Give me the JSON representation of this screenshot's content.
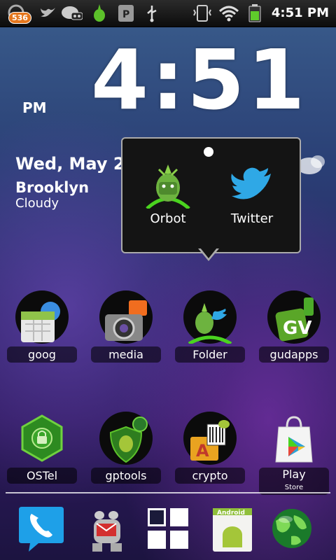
{
  "status_bar": {
    "badge_count": "536",
    "time": "4:51 PM",
    "icons": [
      "notification-icon",
      "twitter-icon",
      "voicemail-icon",
      "orbot-status-icon",
      "parking-icon",
      "usb-icon",
      "vibrate-icon",
      "wifi-icon",
      "battery-icon"
    ],
    "battery_color": "#5fcc2b"
  },
  "clock_widget": {
    "time": "4:51",
    "ampm": "PM",
    "date": "Wed, May 2",
    "location": "Brooklyn",
    "condition": "Cloudy"
  },
  "folder_popup": {
    "apps": [
      {
        "label": "Orbot",
        "icon": "orbot-icon"
      },
      {
        "label": "Twitter",
        "icon": "twitter-bird-icon"
      }
    ]
  },
  "home_row1": [
    {
      "label": "goog",
      "icon": "calendar-icon"
    },
    {
      "label": "media",
      "icon": "camera-icon"
    },
    {
      "label": "Folder",
      "icon": "folder-icon"
    },
    {
      "label": "gudapps",
      "icon": "google-voice-icon"
    }
  ],
  "home_row2": [
    {
      "label": "OSTel",
      "icon": "ostel-icon"
    },
    {
      "label": "gptools",
      "icon": "android-shield-icon"
    },
    {
      "label": "crypto",
      "icon": "crypto-folder-icon"
    },
    {
      "label": "Play",
      "sublabel": "Store",
      "icon": "play-store-icon"
    }
  ],
  "dock": [
    {
      "icon": "phone-icon"
    },
    {
      "icon": "messaging-robot-icon"
    },
    {
      "icon": "app-drawer-icon"
    },
    {
      "icon": "android-market-icon"
    },
    {
      "icon": "browser-globe-icon"
    }
  ],
  "colors": {
    "accent_green": "#4ad31f",
    "twitter_blue": "#2fa8e6",
    "phone_blue": "#1ea0e8"
  }
}
